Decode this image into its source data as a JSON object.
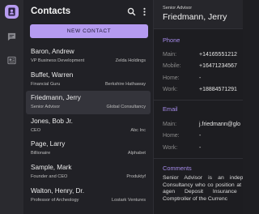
{
  "rail": {
    "items": [
      {
        "name": "contacts-icon",
        "active": true
      },
      {
        "name": "chat-icon",
        "active": false
      },
      {
        "name": "news-icon",
        "active": false
      }
    ]
  },
  "contacts": {
    "title": "Contacts",
    "new_contact_label": "NEW CONTACT",
    "list": [
      {
        "name": "Baron, Andrew",
        "role": "VP Business Development",
        "company": "Zelda Holdings"
      },
      {
        "name": "Buffet, Warren",
        "role": "Financial Guru",
        "company": "Berkshire Hathaway"
      },
      {
        "name": "Friedmann, Jerry",
        "role": "Senior Advisor",
        "company": "Global Consultancy"
      },
      {
        "name": "Jones, Bob Jr.",
        "role": "CEO",
        "company": "Abc Inc"
      },
      {
        "name": "Page, Larry",
        "role": "Billionaire",
        "company": "Alphabet"
      },
      {
        "name": "Sample, Mark",
        "role": "Founder and CEO",
        "company": "Produktyf"
      },
      {
        "name": "Walton, Henry, Dr.",
        "role": "Professor of Archeology",
        "company": "Lostark Ventures"
      }
    ],
    "selected_index": 2
  },
  "detail": {
    "role": "Senior Advisor",
    "name": "Friedmann, Jerry",
    "phone": {
      "title": "Phone",
      "main_label": "Main:",
      "main_value": "+14165551212",
      "mobile_label": "Mobile:",
      "mobile_value": "+16471234567",
      "home_label": "Home:",
      "home_value": "-",
      "work_label": "Work:",
      "work_value": "+18884571291"
    },
    "email": {
      "title": "Email",
      "main_label": "Main:",
      "main_value": "j.friedmann@glo",
      "home_label": "Home:",
      "home_value": "-",
      "work_label": "Work:",
      "work_value": "-"
    },
    "comments_title": "Comments",
    "comments_text": "Senior Advisor is an indepe Global Consultancy who co position at regulatory agen Deposit Insurance Corporat Comptroller of the Currenc"
  },
  "colors": {
    "accent": "#b59bf0",
    "section_title": "#a68bea",
    "background": "#1e1e22"
  }
}
